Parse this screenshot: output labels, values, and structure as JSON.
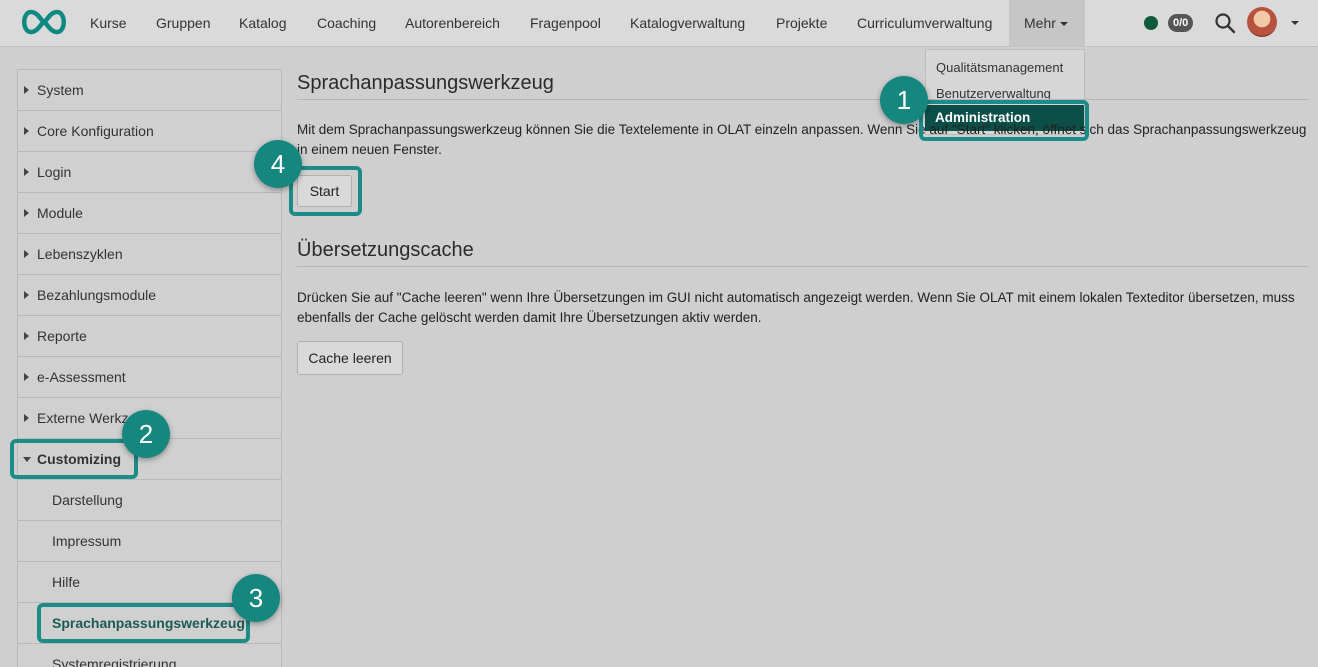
{
  "nav": {
    "items": [
      "Kurse",
      "Gruppen",
      "Katalog",
      "Coaching",
      "Autorenbereich",
      "Fragenpool",
      "Katalogverwaltung",
      "Projekte",
      "Curriculumverwaltung"
    ],
    "more_label": "Mehr",
    "badge": "0/0"
  },
  "dropdown": {
    "items": [
      "Qualitätsmanagement",
      "Benutzerverwaltung"
    ],
    "active": "Administration"
  },
  "sidebar": {
    "items": [
      "System",
      "Core Konfiguration",
      "Login",
      "Module",
      "Lebenszyklen",
      "Bezahlungsmodule",
      "Reporte",
      "e-Assessment",
      "Externe Werkzeuge"
    ],
    "expanded": "Customizing",
    "subitems": [
      "Darstellung",
      "Impressum",
      "Hilfe",
      "Sprachanpassungswerkzeug",
      "Systemregistrierung"
    ]
  },
  "main": {
    "section1_title": "Sprachanpassungswerkzeug",
    "section1_text": "Mit dem Sprachanpassungswerkzeug können Sie die Textelemente in OLAT einzeln anpassen. Wenn Sie auf \"Start\" klicken, öffnet sich das Sprachanpassungswerkzeug in einem neuen Fenster.",
    "start_button": "Start",
    "section2_title": "Übersetzungscache",
    "section2_text": "Drücken Sie auf \"Cache leeren\" wenn Ihre Übersetzungen im GUI nicht automatisch angezeigt werden. Wenn Sie OLAT mit einem lokalen Texteditor übersetzen, muss ebenfalls der Cache gelöscht werden damit Ihre Übersetzungen aktiv werden.",
    "cache_button": "Cache leeren"
  },
  "callouts": [
    "1",
    "2",
    "3",
    "4"
  ],
  "colors": {
    "accent": "#1b8c88",
    "active_menu": "#0b4f48",
    "status": "#0e5a3a"
  }
}
